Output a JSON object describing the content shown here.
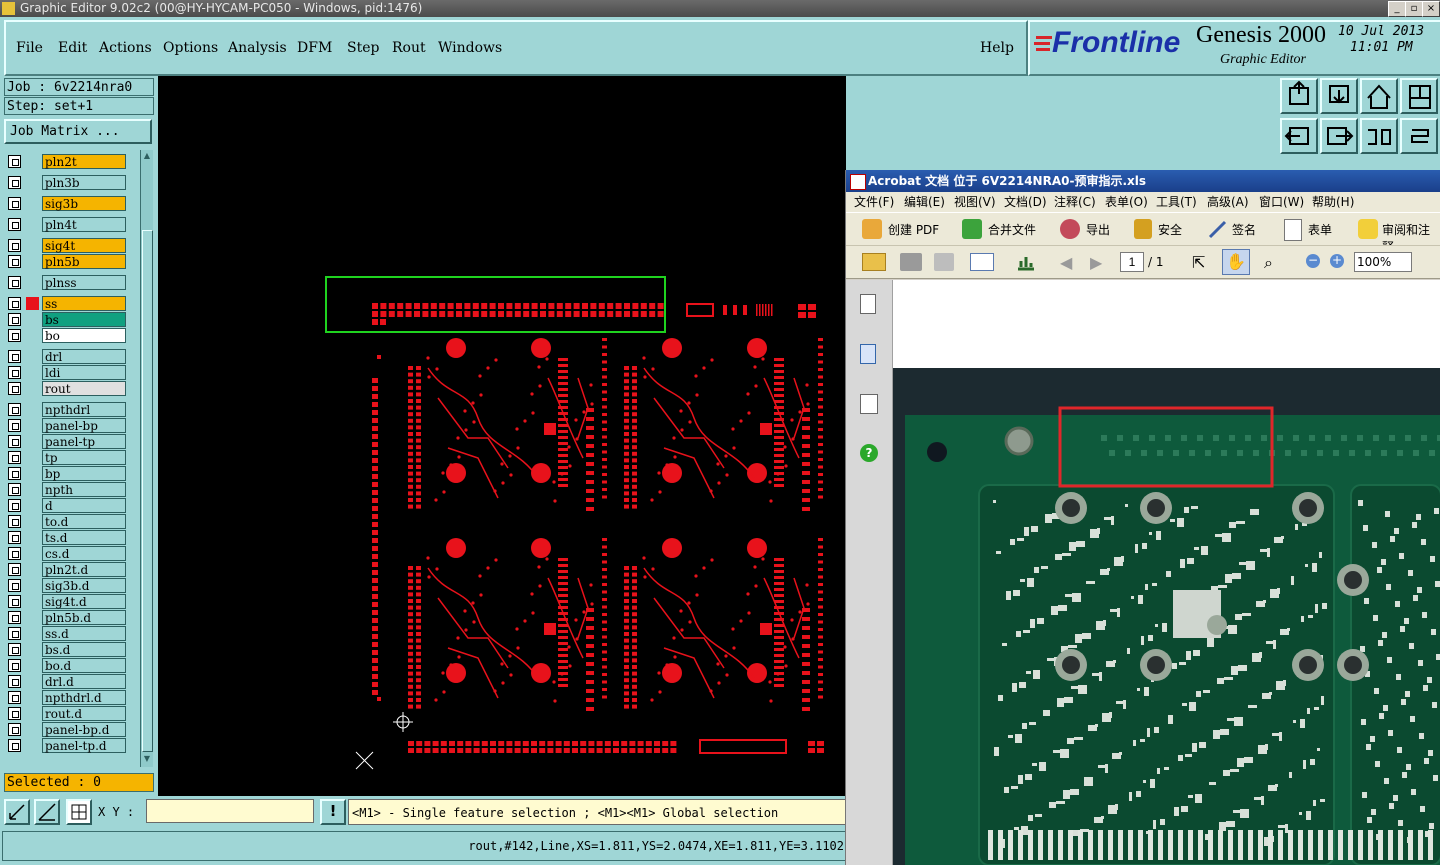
{
  "window": {
    "title": "Graphic Editor 9.02c2 (00@HY-HYCAM-PC050 - Windows, pid:1476)"
  },
  "menu": [
    "File",
    "Edit",
    "Actions",
    "Options",
    "Analysis",
    "DFM",
    "Step",
    "Rout",
    "Windows"
  ],
  "help": "Help",
  "brand": {
    "logo": "Frontline",
    "product": "Genesis 2000",
    "subtitle": "Graphic Editor",
    "date": "10 Jul 2013",
    "time": "11:01 PM"
  },
  "job": {
    "job_label": "Job : 6v2214nra0",
    "step_label": "Step: set+1",
    "matrix_button": "Job Matrix ..."
  },
  "layers": [
    {
      "name": "pln2t",
      "color": "#f5b400"
    },
    {
      "name": "pln3b",
      "color": "#9fd6d6"
    },
    {
      "name": "sig3b",
      "color": "#f5b400"
    },
    {
      "name": "pln4t",
      "color": "#9fd6d6"
    },
    {
      "name": "sig4t",
      "color": "#f5b400"
    },
    {
      "name": "pln5b",
      "color": "#f5b400"
    },
    {
      "name": "plnss",
      "color": "#9fd6d6"
    },
    {
      "name": "ss",
      "color": "#f5b400"
    },
    {
      "name": "bs",
      "color": "#10a080"
    },
    {
      "name": "bo",
      "color": "#ffffff"
    },
    {
      "name": "drl",
      "color": "#9fd6d6"
    },
    {
      "name": "ldi",
      "color": "#9fd6d6"
    },
    {
      "name": "rout",
      "color": "#e0e0e0"
    },
    {
      "name": "npthdrl",
      "color": "#9fd6d6"
    },
    {
      "name": "panel-bp",
      "color": "#9fd6d6"
    },
    {
      "name": "panel-tp",
      "color": "#9fd6d6"
    },
    {
      "name": "tp",
      "color": "#9fd6d6"
    },
    {
      "name": "bp",
      "color": "#9fd6d6"
    },
    {
      "name": "npth",
      "color": "#9fd6d6"
    },
    {
      "name": "d",
      "color": "#9fd6d6"
    },
    {
      "name": "to.d",
      "color": "#9fd6d6"
    },
    {
      "name": "ts.d",
      "color": "#9fd6d6"
    },
    {
      "name": "cs.d",
      "color": "#9fd6d6"
    },
    {
      "name": "pln2t.d",
      "color": "#9fd6d6"
    },
    {
      "name": "sig3b.d",
      "color": "#9fd6d6"
    },
    {
      "name": "sig4t.d",
      "color": "#9fd6d6"
    },
    {
      "name": "pln5b.d",
      "color": "#9fd6d6"
    },
    {
      "name": "ss.d",
      "color": "#9fd6d6"
    },
    {
      "name": "bs.d",
      "color": "#9fd6d6"
    },
    {
      "name": "bo.d",
      "color": "#9fd6d6"
    },
    {
      "name": "drl.d",
      "color": "#9fd6d6"
    },
    {
      "name": "npthdrl.d",
      "color": "#9fd6d6"
    },
    {
      "name": "rout.d",
      "color": "#9fd6d6"
    },
    {
      "name": "panel-bp.d",
      "color": "#9fd6d6"
    },
    {
      "name": "panel-tp.d",
      "color": "#9fd6d6"
    }
  ],
  "selected": "Selected : 0",
  "xy_label": "X Y :",
  "xy_value": "",
  "message": "<M1> - Single feature selection ; <M1><M1> Global selection",
  "info": "rout,#142,Line,XS=1.811,YS=2.0474,XE=1.811,YE=3.1102",
  "acrobat": {
    "title": "Acrobat 文档 位于 6V2214NRA0-预审指示.xls",
    "menu": [
      "文件(F)",
      "编辑(E)",
      "视图(V)",
      "文档(D)",
      "注释(C)",
      "表单(O)",
      "工具(T)",
      "高级(A)",
      "窗口(W)",
      "帮助(H)"
    ],
    "toolbar": [
      "创建 PDF",
      "合并文件",
      "导出",
      "安全",
      "签名",
      "表单",
      "审阅和注释"
    ],
    "page_current": "1",
    "page_total": "/ 1",
    "zoom": "100%"
  },
  "colors": {
    "canvas": "#000000",
    "features": "#e8121b",
    "highlight_canvas": "#1fd31f",
    "highlight_photo": "#e0262a",
    "panel": "#9fd6d6"
  }
}
